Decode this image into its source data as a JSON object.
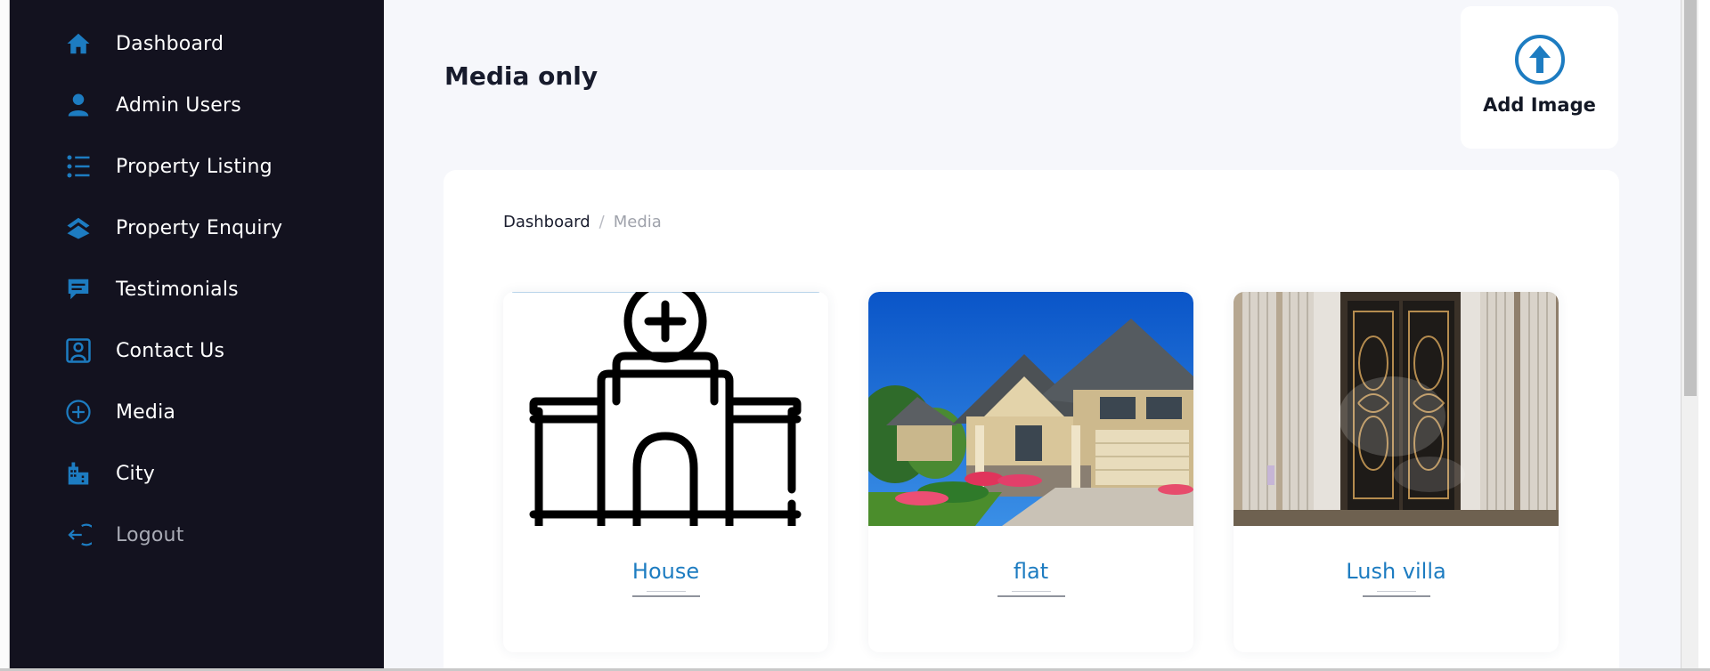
{
  "sidebar": {
    "items": [
      {
        "label": "Dashboard",
        "icon": "home-icon"
      },
      {
        "label": "Admin Users",
        "icon": "user-icon"
      },
      {
        "label": "Property Listing",
        "icon": "list-icon"
      },
      {
        "label": "Property Enquiry",
        "icon": "layers-icon"
      },
      {
        "label": "Testimonials",
        "icon": "chat-icon"
      },
      {
        "label": "Contact Us",
        "icon": "contact-icon"
      },
      {
        "label": "Media",
        "icon": "plus-circle-icon"
      },
      {
        "label": "City",
        "icon": "city-icon"
      },
      {
        "label": "Logout",
        "icon": "logout-icon"
      }
    ]
  },
  "header": {
    "title": "Media only",
    "add_button_label": "Add Image"
  },
  "breadcrumb": {
    "home": "Dashboard",
    "separator": "/",
    "current": "Media"
  },
  "media": [
    {
      "name": "House"
    },
    {
      "name": "flat"
    },
    {
      "name": "Lush villa"
    }
  ],
  "colors": {
    "sidebar_bg": "#13121f",
    "accent": "#1d7cc1",
    "page_bg": "#f6f7fb"
  }
}
